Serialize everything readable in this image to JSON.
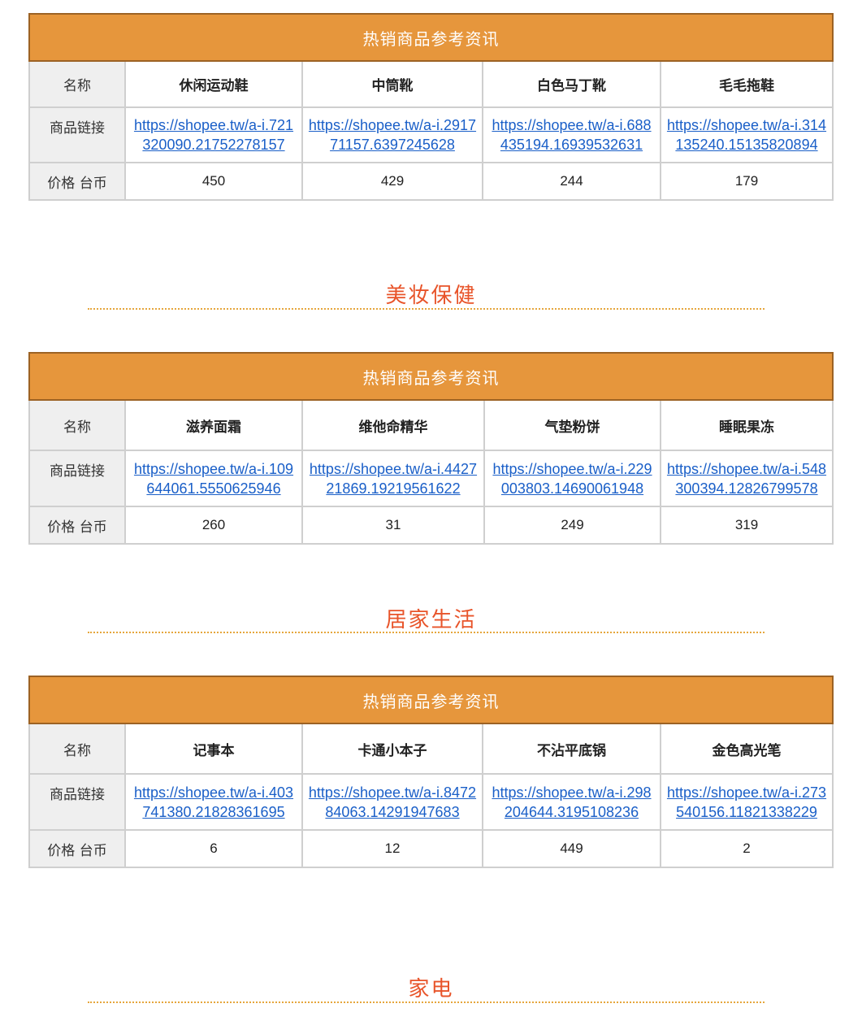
{
  "row_labels": {
    "name": "名称",
    "link": "商品链接",
    "price": "价格 台币"
  },
  "tables": [
    {
      "header": "热销商品参考资讯",
      "products": [
        {
          "name": "休闲运动鞋",
          "link": "https://shopee.tw/a-i.721320090.21752278157",
          "price": "450"
        },
        {
          "name": "中筒靴",
          "link": "https://shopee.tw/a-i.291771157.6397245628",
          "price": "429"
        },
        {
          "name": "白色马丁靴",
          "link": "https://shopee.tw/a-i.688435194.16939532631",
          "price": "244"
        },
        {
          "name": "毛毛拖鞋",
          "link": "https://shopee.tw/a-i.314135240.15135820894",
          "price": "179"
        }
      ]
    },
    {
      "header": "热销商品参考资讯",
      "products": [
        {
          "name": "滋养面霜",
          "link": "https://shopee.tw/a-i.109644061.5550625946",
          "price": "260"
        },
        {
          "name": "维他命精华",
          "link": "https://shopee.tw/a-i.442721869.19219561622",
          "price": "31"
        },
        {
          "name": "气垫粉饼",
          "link": "https://shopee.tw/a-i.229003803.14690061948",
          "price": "249"
        },
        {
          "name": "睡眠果冻",
          "link": "https://shopee.tw/a-i.548300394.12826799578",
          "price": "319"
        }
      ]
    },
    {
      "header": "热销商品参考资讯",
      "products": [
        {
          "name": "记事本",
          "link": "https://shopee.tw/a-i.403741380.21828361695",
          "price": "6"
        },
        {
          "name": "卡通小本子",
          "link": "https://shopee.tw/a-i.847284063.14291947683",
          "price": "12"
        },
        {
          "name": "不沾平底锅",
          "link": "https://shopee.tw/a-i.298204644.3195108236",
          "price": "449"
        },
        {
          "name": "金色高光笔",
          "link": "https://shopee.tw/a-i.273540156.11821338229",
          "price": "2"
        }
      ]
    }
  ],
  "sections": [
    {
      "title": "美妆保健"
    },
    {
      "title": "居家生活"
    },
    {
      "title": "家电"
    }
  ],
  "colors": {
    "header_bg": "#e6963c",
    "header_border": "#9c6224",
    "section_title": "#e8542a",
    "link": "#1a5fc8",
    "label_bg": "#efefef"
  }
}
